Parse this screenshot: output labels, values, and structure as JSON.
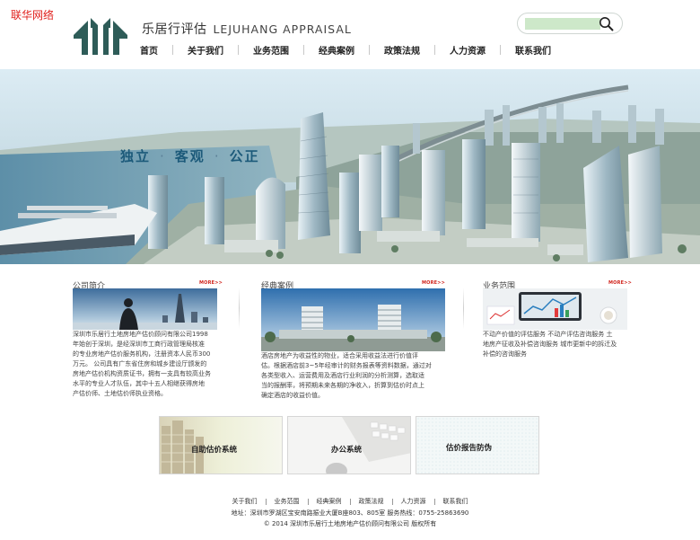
{
  "watermark": "联华网络",
  "brand": {
    "name_cn": "乐居行评估",
    "name_en": "LEJUHANG APPRAISAL"
  },
  "search": {
    "placeholder": ""
  },
  "nav": [
    "首页",
    "关于我们",
    "业务范围",
    "经典案例",
    "政策法规",
    "人力资源",
    "联系我们"
  ],
  "banner": {
    "slogan": [
      "独立",
      "客观",
      "公正"
    ]
  },
  "sections": {
    "about": {
      "title": "公司简介",
      "more": "MORE>>",
      "lines": [
        "深圳市乐居行土地房地产估价顾问有限公司1998",
        "年始创于深圳，是经深圳市工商行政管理局核准",
        "的专业房地产估价服务机构，注册资本人民币300",
        "万元。 公司具有广东省住房和城乡建设厅颁发的",
        "房地产估价机构资质证书，拥有一支具有较高业务",
        "水平的专业人才队伍，其中十五人相继获得房地",
        "产估价师、土地估价师执业资格。"
      ]
    },
    "cases": {
      "title": "经典案例",
      "more": "MORE>>",
      "lines": [
        "酒店房地产为收益性的物业，适合采用收益法进行价值评",
        "估。根据酒店前3~5年经审计的财务报表等资料数据，通过对",
        "各类型收入、运营费用及酒店行业利润的分析测算，选取适",
        "当的报酬率，将预期未来各期的净收入，折算到估价时点上",
        "确定酒店的收益价值。"
      ]
    },
    "business": {
      "title": "业务范围",
      "more": "MORE>>",
      "lines": [
        "不动产价值的评估服务 不动产评估咨询服务 土",
        "地房产征收及补偿咨询服务 城市更新中的拆迁及",
        "补偿的咨询服务"
      ]
    }
  },
  "tiles": [
    "自助估价系统",
    "办公系统",
    "估价报告防伪"
  ],
  "footer": {
    "links": [
      "关于我们",
      "业务范围",
      "经典案例",
      "政策法规",
      "人力资源",
      "联系我们"
    ],
    "address": "地址：深圳市罗湖区宝安南路振业大厦B座803、805室  服务热线：0755-25863690",
    "copyright": "© 2014  深圳市乐居行土地房地产估价顾问有限公司 版权所有"
  }
}
